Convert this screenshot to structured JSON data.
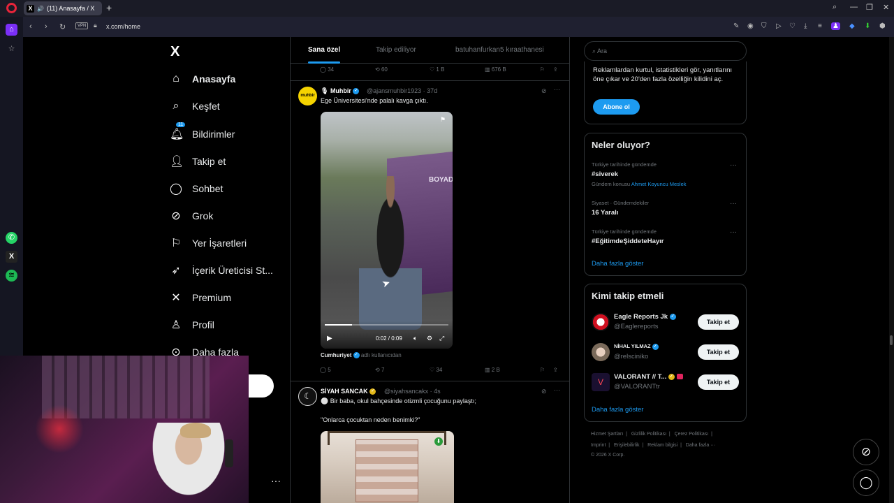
{
  "browser": {
    "tab_title": "(11) Anasayfa / X",
    "url": "x.com/home",
    "vpn_label": "VPN"
  },
  "nav": {
    "logo": "X",
    "items": [
      {
        "label": "Anasayfa",
        "icon": "home-icon"
      },
      {
        "label": "Keşfet",
        "icon": "search-icon"
      },
      {
        "label": "Bildirimler",
        "icon": "bell-icon",
        "badge": "11"
      },
      {
        "label": "Takip et",
        "icon": "follow-icon"
      },
      {
        "label": "Sohbet",
        "icon": "chat-icon"
      },
      {
        "label": "Grok",
        "icon": "grok-icon"
      },
      {
        "label": "Yer İşaretleri",
        "icon": "bookmark-icon"
      },
      {
        "label": "İçerik Üreticisi St...",
        "icon": "rocket-icon"
      },
      {
        "label": "Premium",
        "icon": "x-icon"
      },
      {
        "label": "Profil",
        "icon": "profile-icon"
      },
      {
        "label": "Daha fazla",
        "icon": "more-icon"
      }
    ]
  },
  "feed": {
    "tabs": [
      "Sana özel",
      "Takip ediliyor",
      "batuhanfurkan5 kıraathanesi"
    ],
    "prev_actions": {
      "replies": "34",
      "reposts": "60",
      "likes": "1 B",
      "views": "676 B"
    },
    "post1": {
      "name": "Muhbir",
      "handle": "@ajansmuhbir1923 · 37d",
      "avatar_text": "muhbir",
      "text": "Ege Üniversitesi'nde palalı kavga çıktı.",
      "video_time": "0:02 / 0:09",
      "video_progress": 0.22,
      "video_overlay_text": "BOYAD",
      "source_name": "Cumhuriyet",
      "source_suffix": "adlı kullanıcıdan",
      "replies": "5",
      "reposts": "7",
      "likes": "34",
      "views": "2 B"
    },
    "post2": {
      "name": "SİYAH SANCAK",
      "handle": "@siyahsancakx · 4s",
      "text": "⚪ Bir baba, okul bahçesinde otizmli çocuğunu paylaştı;",
      "quote": "\"Onlarca çocuktan neden benimki?\""
    }
  },
  "right": {
    "search_placeholder": "Ara",
    "premium_text": "Reklamlardan kurtul, istatistikleri gör, yanıtlarını öne çıkar ve 20'den fazla özelliğin kilidini aç.",
    "subscribe_label": "Abone ol",
    "trends_title": "Neler oluyor?",
    "trends": [
      {
        "context": "Türkiye tarihinde gündemde",
        "name": "#siverek",
        "topic_prefix": "Gündem konusu",
        "topic_link": "Ahmet Koyuncu Meslek"
      },
      {
        "context": "Siyaset · Gündemdekiler",
        "name": "16 Yaralı"
      },
      {
        "context": "Türkiye tarihinde gündemde",
        "name": "#EğitimdeŞiddeteHayır"
      }
    ],
    "show_more": "Daha fazla göster",
    "who_title": "Kimi takip etmeli",
    "who": [
      {
        "name": "Eagle Reports Jk",
        "handle": "@Eaglereports",
        "button": "Takip et"
      },
      {
        "name": "NİHAL YILMAZ",
        "handle": "@relsciniko",
        "button": "Takip et"
      },
      {
        "name": "VALORANT // T...",
        "handle": "@VALORANTtr",
        "button": "Takip et"
      }
    ],
    "who_more": "Daha fazla göster",
    "footer_line1": [
      "Hizmet Şartları",
      "Gizlilik Politikası",
      "Çerez Politikası"
    ],
    "footer_line2": [
      "Imprint",
      "Erişilebilirlik",
      "Reklam bilgisi",
      "Daha fazla ···"
    ],
    "copyright": "© 2026 X Corp."
  },
  "colors": {
    "accent": "#1d9bf0",
    "background": "#000000",
    "border": "#2f3336"
  }
}
